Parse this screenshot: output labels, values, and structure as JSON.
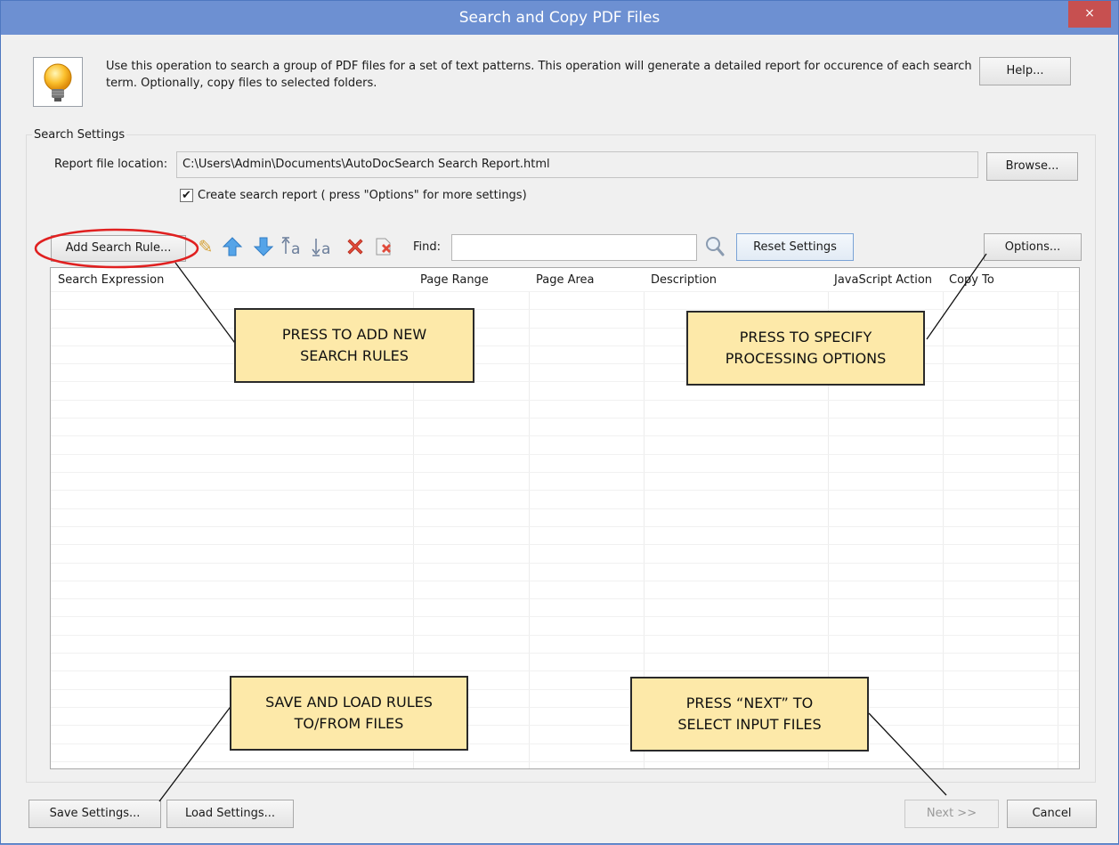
{
  "window": {
    "title": "Search and Copy PDF Files",
    "close_glyph": "×"
  },
  "intro": {
    "text": "Use this operation to search a group of PDF files for a set of text patterns. This operation will generate a detailed report for occurence of each search term. Optionally, copy files to selected folders.",
    "help_label": "Help...",
    "icon": "lightbulb-icon"
  },
  "search_settings": {
    "group_label": "Search Settings",
    "report_label": "Report file location:",
    "report_path": "C:\\Users\\Admin\\Documents\\AutoDocSearch Search Report.html",
    "browse_label": "Browse...",
    "create_report_checked": true,
    "create_report_label": "Create search report ( press \"Options\" for more settings)"
  },
  "toolbar": {
    "add_rule_label": "Add Search Rule...",
    "find_label": "Find:",
    "find_value": "",
    "reset_label": "Reset Settings",
    "options_label": "Options...",
    "icons": [
      "pencil-icon",
      "arrow-up-icon",
      "arrow-down-icon",
      "move-to-top-icon",
      "move-to-bottom-icon",
      "delete-icon",
      "clear-all-icon",
      "magnifier-icon"
    ]
  },
  "table": {
    "columns": [
      "Search Expression",
      "Page Range",
      "Page Area",
      "Description",
      "JavaScript Action",
      "Copy To"
    ],
    "rows": []
  },
  "callouts": {
    "add_rules": "PRESS TO ADD NEW SEARCH RULES",
    "options": "PRESS TO SPECIFY PROCESSING OPTIONS",
    "save_load": "SAVE AND LOAD RULES TO/FROM FILES",
    "next": "PRESS “NEXT” TO SELECT INPUT FILES"
  },
  "footer": {
    "save_label": "Save Settings...",
    "load_label": "Load Settings...",
    "next_label": "Next >>",
    "cancel_label": "Cancel"
  },
  "colors": {
    "titlebar": "#6d90d2",
    "callout_fill": "#fde9a9",
    "highlight_ring": "#e02020"
  }
}
